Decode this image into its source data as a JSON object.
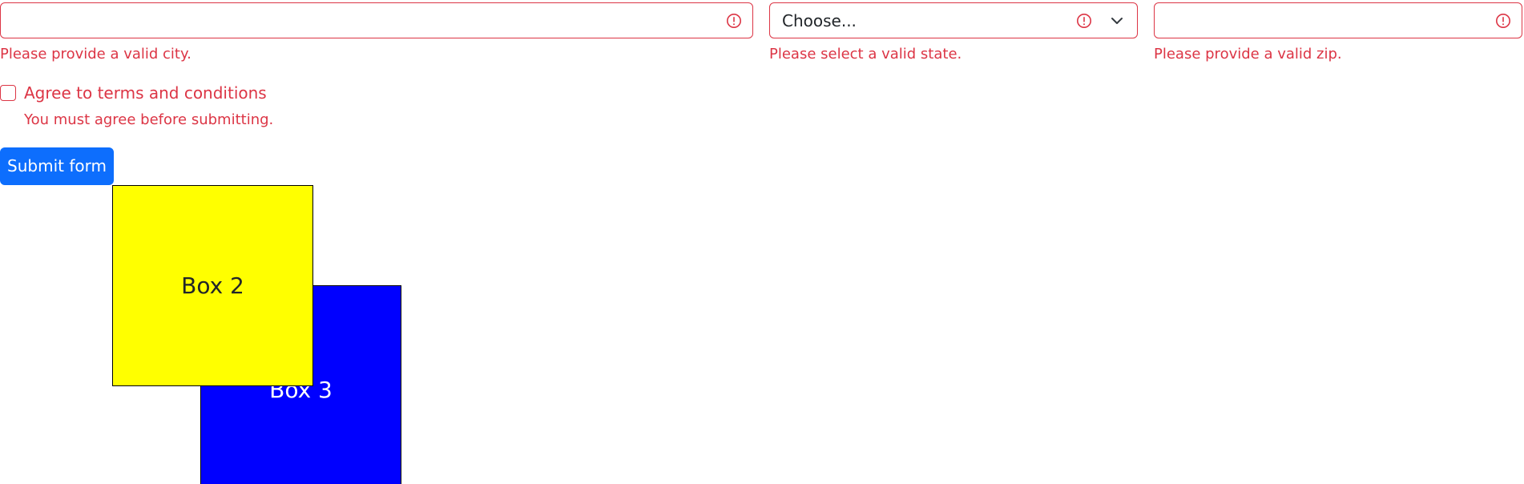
{
  "form": {
    "city": {
      "value": "",
      "feedback": "Please provide a valid city."
    },
    "state": {
      "selected": "Choose...",
      "feedback": "Please select a valid state."
    },
    "zip": {
      "value": "",
      "feedback": "Please provide a valid zip."
    },
    "terms": {
      "label": "Agree to terms and conditions",
      "feedback": "You must agree before submitting.",
      "checked": false
    },
    "submit_label": "Submit form"
  },
  "boxes": {
    "box2_label": "Box 2",
    "box3_label": "Box 3"
  },
  "colors": {
    "invalid": "#dc3545",
    "primary": "#0d6efd",
    "box2": "#ffff00",
    "box3": "#0000ff"
  },
  "icons": {
    "invalid": "exclamation-circle-icon",
    "select": "chevron-down-icon"
  }
}
